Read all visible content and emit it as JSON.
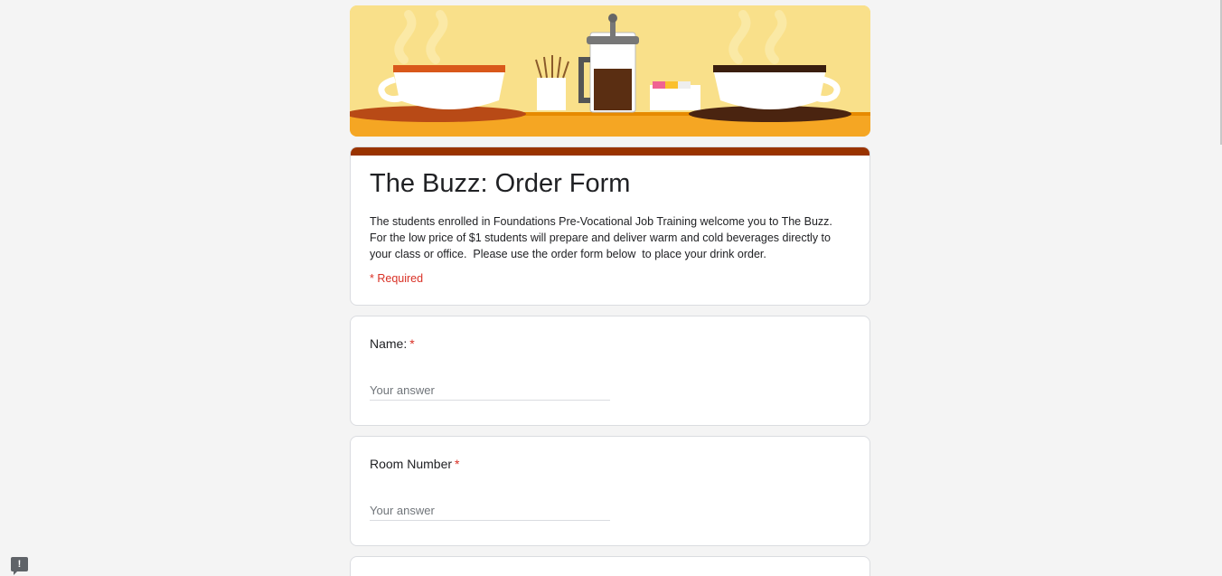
{
  "form": {
    "title": "The Buzz: Order Form",
    "description": "The students enrolled in Foundations Pre-Vocational Job Training welcome you to The Buzz.  For the low price of $1 students will prepare and deliver warm and cold beverages directly to your class or office.  Please use the order form below  to place your drink order.",
    "required_note": "* Required",
    "accent_color": "#993300"
  },
  "questions": [
    {
      "label": "Name:",
      "required_marker": "*",
      "placeholder": "Your answer"
    },
    {
      "label": "Room Number",
      "required_marker": "*",
      "placeholder": "Your answer"
    }
  ],
  "feedback": {
    "icon": "report-icon",
    "glyph": "!"
  }
}
